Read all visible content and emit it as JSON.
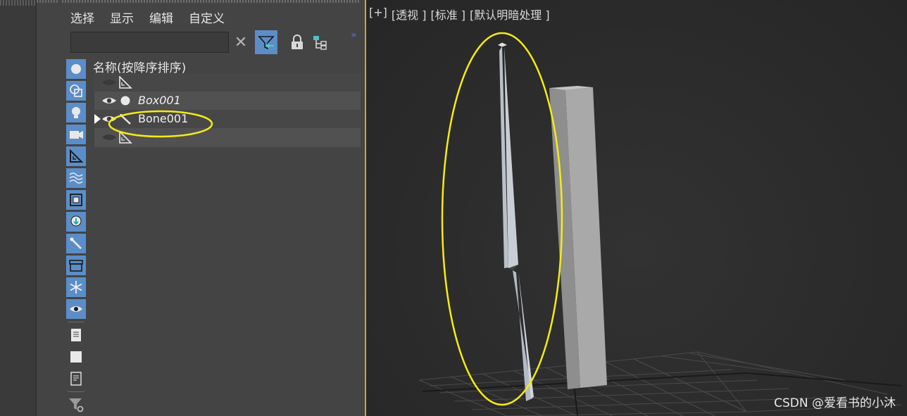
{
  "explorer": {
    "menu": [
      "选择",
      "显示",
      "编辑",
      "自定义"
    ],
    "search_placeholder": "",
    "column_header": "名称(按降序排序)",
    "rows": [
      {
        "name": "",
        "type": "helper-icon",
        "visible": false
      },
      {
        "name": "Box001",
        "type": "geometry-icon",
        "visible": true,
        "italic": true
      },
      {
        "name": "Bone001",
        "type": "bone-icon",
        "visible": true,
        "expanded": true
      },
      {
        "name": "",
        "type": "helper-icon",
        "visible": false
      }
    ],
    "filter_chevron": "»"
  },
  "viewport": {
    "labels": [
      "[+]",
      "[透视 ]",
      "[标准 ]",
      "[默认明暗处理 ]"
    ],
    "watermark": "CSDN @爱看书的小沐"
  },
  "colors": {
    "accent": "#5b8ec9",
    "highlight": "#f5eb14",
    "divider": "#c8a836"
  }
}
